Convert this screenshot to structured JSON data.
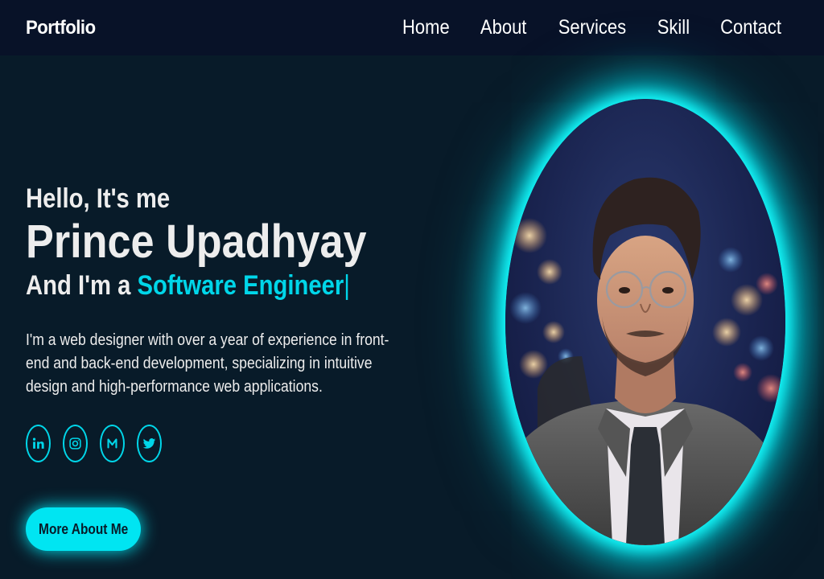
{
  "header": {
    "logo": "Portfolio",
    "nav": [
      "Home",
      "About",
      "Services",
      "Skill",
      "Contact"
    ]
  },
  "hero": {
    "greeting": "Hello, It's me",
    "name": "Prince Upadhyay",
    "role_prefix": "And I'm a",
    "role": "Software Engineer",
    "caret": "|",
    "bio": "I'm a web designer with over a year of experience in front-end and back-end development, specializing in intuitive design and high-performance web applications.",
    "socials": [
      {
        "icon": "linkedin-icon"
      },
      {
        "icon": "instagram-icon"
      },
      {
        "icon": "medium-icon"
      },
      {
        "icon": "twitter-icon"
      }
    ],
    "cta_label": "More About Me"
  },
  "colors": {
    "accent": "#00d6e9",
    "background": "#081b29",
    "navbar": "#081228"
  }
}
